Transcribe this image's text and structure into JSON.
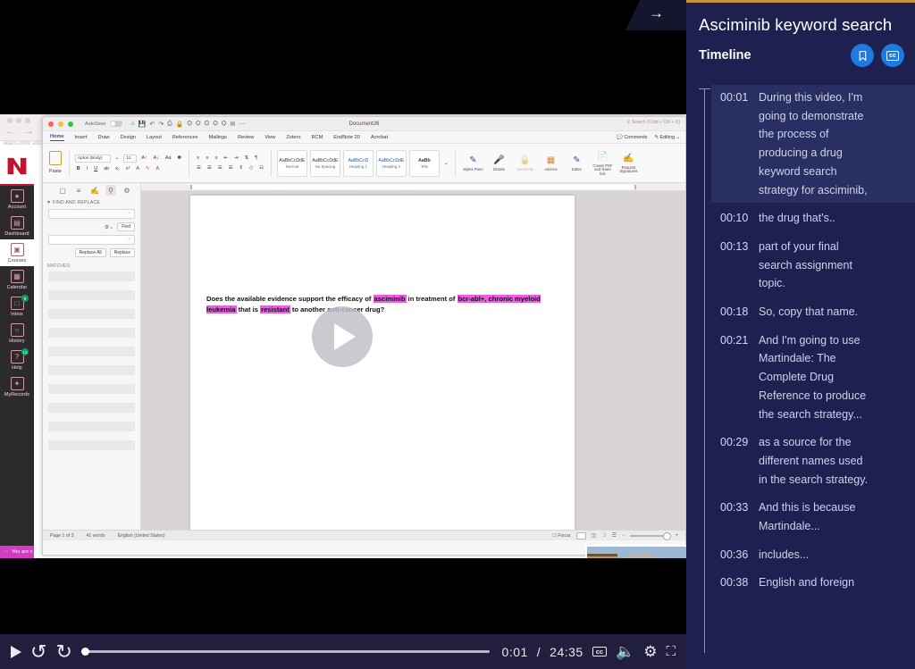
{
  "panel": {
    "title": "Asciminib keyword search",
    "subtitle": "Timeline",
    "bookmark_icon": "bookmark-icon",
    "cc_icon": "cc-icon",
    "cc_label": "cc",
    "accent_blue": "#1f7ae0",
    "background": "#1e2150"
  },
  "collapse": {
    "icon": "arrow-right-icon",
    "glyph": "→"
  },
  "transcript": [
    {
      "time": "00:01",
      "text": "During this video, I'm going to demonstrate the process of producing a drug keyword search strategy for asciminib,",
      "active": true
    },
    {
      "time": "00:10",
      "text": "the drug that's..",
      "active": false
    },
    {
      "time": "00:13",
      "text": "part of your final search assignment topic.",
      "active": false
    },
    {
      "time": "00:18",
      "text": "So, copy that name.",
      "active": false
    },
    {
      "time": "00:21",
      "text": "And I'm going to use Martindale: The Complete Drug Reference to produce the search strategy...",
      "active": false
    },
    {
      "time": "00:29",
      "text": "as a source for the different names used in the search strategy.",
      "active": false
    },
    {
      "time": "00:33",
      "text": "And this is because Martindale...",
      "active": false
    },
    {
      "time": "00:36",
      "text": "includes...",
      "active": false
    },
    {
      "time": "00:38",
      "text": "English and foreign",
      "active": false
    }
  ],
  "player": {
    "play_icon": "play-icon",
    "rewind_icon": "rewind-10-icon",
    "forward_icon": "forward-10-icon",
    "current_time": "0:01",
    "separator": "/",
    "total_time": "24:35",
    "cc_label": "cc",
    "volume_icon": "volume-icon",
    "settings_icon": "gear-icon",
    "fullscreen_icon": "fullscreen-icon",
    "progress_percent": 0.07
  },
  "video": {
    "play_overlay_icon": "play-overlay-icon",
    "webcam_label": "presenter-webcam"
  },
  "lms": {
    "logo": "university-n-logo",
    "items": [
      {
        "label": "Account",
        "icon": "account-icon",
        "active": false,
        "badge": ""
      },
      {
        "label": "Dashboard",
        "icon": "dashboard-icon",
        "active": false,
        "badge": ""
      },
      {
        "label": "Courses",
        "icon": "courses-icon",
        "active": true,
        "badge": ""
      },
      {
        "label": "Calendar",
        "icon": "calendar-icon",
        "active": false,
        "badge": ""
      },
      {
        "label": "Inbox",
        "icon": "inbox-icon",
        "active": false,
        "badge": "9"
      },
      {
        "label": "History",
        "icon": "history-icon",
        "active": false,
        "badge": ""
      },
      {
        "label": "Help",
        "icon": "help-icon",
        "active": false,
        "badge": "12"
      },
      {
        "label": "MyRecords",
        "icon": "myrecords-icon",
        "active": false,
        "badge": ""
      }
    ],
    "footer": "You are c",
    "footer_icon": "glasses-icon"
  },
  "browser": {
    "back_icon": "back-arrow-icon",
    "forward_icon": "forward-arrow-icon",
    "reload_icon": "reload-icon",
    "url": "ilearn.unmc.edu"
  },
  "word": {
    "autosave_label": "AutoSave",
    "document_title": "Document26",
    "search_placeholder": "Search (Cmd + Ctrl + U)",
    "quick_access": [
      "home-icon",
      "save-icon",
      "undo-icon",
      "redo-icon",
      "print-icon",
      "lock-icon",
      "org-icon",
      "org-icon",
      "org-icon",
      "org-icon",
      "org-icon",
      "mail-icon",
      "more-icon"
    ],
    "tabs": [
      "Home",
      "Insert",
      "Draw",
      "Design",
      "Layout",
      "References",
      "Mailings",
      "Review",
      "View",
      "Zotero",
      "RCM",
      "EndNote 20",
      "Acrobat"
    ],
    "active_tab": "Home",
    "comments_label": "Comments",
    "editing_label": "Editing",
    "ribbon": {
      "paste_label": "Paste",
      "font_name": "Aptos (Body)",
      "font_size": "12",
      "styles": [
        {
          "preview": "AaBbCcDdE",
          "name": "Normal"
        },
        {
          "preview": "AaBbCcDdE",
          "name": "No Spacing"
        },
        {
          "preview": "AaBbCcD",
          "name": "Heading 1"
        },
        {
          "preview": "AaBbCcDdE",
          "name": "Heading 2"
        },
        {
          "preview": "AaBb",
          "name": "Title"
        }
      ],
      "commands": [
        {
          "label": "Styles Pane",
          "icon": "styles-pane-icon"
        },
        {
          "label": "Dictate",
          "icon": "microphone-icon"
        },
        {
          "label": "Sensitivity",
          "icon": "sensitivity-icon"
        },
        {
          "label": "Add-ins",
          "icon": "addins-icon"
        },
        {
          "label": "Editor",
          "icon": "editor-icon"
        },
        {
          "label": "Create PDF and share link",
          "icon": "pdf-icon"
        },
        {
          "label": "Request Signatures",
          "icon": "signature-icon"
        }
      ]
    },
    "find_pane": {
      "tabs": [
        "thumbnail-icon",
        "outline-icon",
        "review-icon",
        "search-icon",
        "settings-icon"
      ],
      "heading": "FIND AND REPLACE",
      "find_button": "Find",
      "replace_all_button": "Replace All",
      "replace_button": "Replace",
      "matches_label": "MATCHES:",
      "find_value": "",
      "replace_value": ""
    },
    "document": {
      "q_part1": "Does the available evidence support the efficacy of ",
      "hl1": "asciminib",
      "q_part2": " in treatment of ",
      "hl2": "bcr-abl+, chronic myeloid leukemia",
      "q_part3": " that is ",
      "hl3": "resistant",
      "q_part4": " to another anti-cancer drug?",
      "highlight_color": "#e85fe0"
    },
    "status": {
      "page": "Page 1 of 3",
      "words": "41 words",
      "language": "English (United States)",
      "focus_label": "Focus",
      "zoom_icon": "zoom-slider"
    }
  }
}
